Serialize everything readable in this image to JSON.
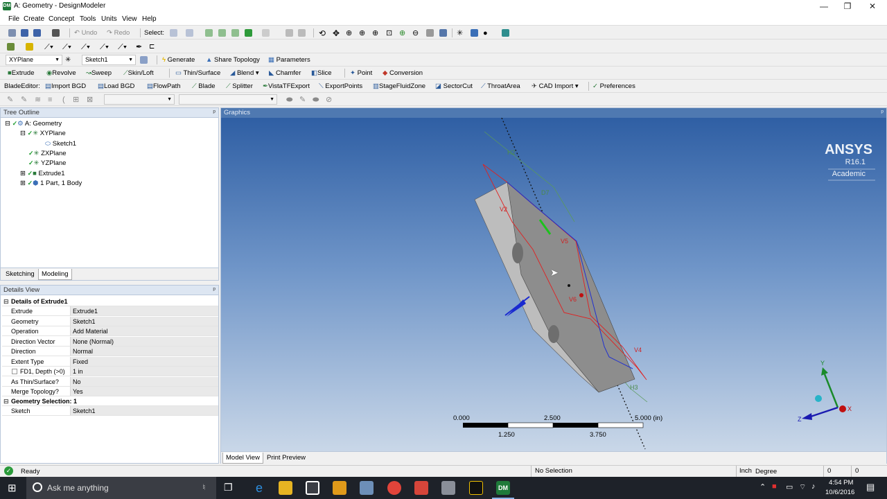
{
  "window": {
    "title": "A: Geometry - DesignModeler",
    "app_badge": "DM",
    "min": "—",
    "max": "❐",
    "close": "✕"
  },
  "menu": [
    "File",
    "Create",
    "Concept",
    "Tools",
    "Units",
    "View",
    "Help"
  ],
  "toolbar1": {
    "undo": "Undo",
    "redo": "Redo",
    "select_label": "Select:"
  },
  "toolbar2": {
    "plane": "XYPlane",
    "sketch": "Sketch1",
    "generate": "Generate",
    "share_topology": "Share Topology",
    "parameters": "Parameters"
  },
  "toolbar3": [
    "Extrude",
    "Revolve",
    "Sweep",
    "Skin/Loft",
    "Thin/Surface",
    "Blend",
    "Chamfer",
    "Slice",
    "Point",
    "Conversion"
  ],
  "toolbar4": {
    "label": "BladeEditor:",
    "items": [
      "Import BGD",
      "Load BGD",
      "FlowPath",
      "Blade",
      "Splitter",
      "VistaTFExport",
      "ExportPoints",
      "StageFluidZone",
      "SectorCut",
      "ThroatArea",
      "CAD Import",
      "Preferences"
    ]
  },
  "tree": {
    "header": "Tree Outline",
    "pin": "ᵖ",
    "items": [
      "A: Geometry",
      "XYPlane",
      "Sketch1",
      "ZXPlane",
      "YZPlane",
      "Extrude1",
      "1 Part, 1 Body"
    ],
    "tabs": [
      "Sketching",
      "Modeling"
    ]
  },
  "details": {
    "header": "Details View",
    "section1": "Details of Extrude1",
    "rows": [
      [
        "Extrude",
        "Extrude1"
      ],
      [
        "Geometry",
        "Sketch1"
      ],
      [
        "Operation",
        "Add Material"
      ],
      [
        "Direction Vector",
        "None (Normal)"
      ],
      [
        "Direction",
        "Normal"
      ],
      [
        "Extent Type",
        "Fixed"
      ],
      [
        "FD1, Depth (>0)",
        "1 in"
      ],
      [
        "As Thin/Surface?",
        "No"
      ],
      [
        "Merge Topology?",
        "Yes"
      ]
    ],
    "section2": "Geometry Selection: 1",
    "sketch_row": [
      "Sketch",
      "Sketch1"
    ]
  },
  "graphics": {
    "header": "Graphics",
    "brand": "ANSYS",
    "version": "R16.1",
    "edition": "Academic",
    "scale_top": [
      "0.000",
      "2.500",
      "5.000 (in)"
    ],
    "scale_bottom": [
      "1.250",
      "3.750"
    ],
    "dims": [
      "H2",
      "D7",
      "V2",
      "V5",
      "V6",
      "V4",
      "H3"
    ],
    "axes": [
      "Y",
      "X",
      "Z"
    ],
    "tabs": [
      "Model View",
      "Print Preview"
    ]
  },
  "status": {
    "ready": "Ready",
    "selection": "No Selection",
    "units_len": "Inch",
    "units_ang": "Degree",
    "f1": "0",
    "f2": "0"
  },
  "taskbar": {
    "search": "Ask me anything",
    "time": "4:54 PM",
    "date": "10/6/2016"
  }
}
